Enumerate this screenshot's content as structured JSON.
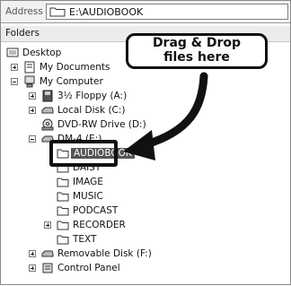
{
  "address": {
    "label": "Address",
    "path": "E:\\AUDIOBOOK"
  },
  "panel": {
    "title": "Folders"
  },
  "tree": {
    "desktop": "Desktop",
    "my_documents": "My Documents",
    "my_computer": "My Computer",
    "floppy": "3½ Floppy (A:)",
    "local_disk": "Local Disk (C:)",
    "dvd": "DVD-RW Drive (D:)",
    "dm4": "DM-4 (E:)",
    "audiobook": "AUDIOBOOK",
    "daisy": "DAISY",
    "image": "IMAGE",
    "music": "MUSIC",
    "podcast": "PODCAST",
    "recorder": "RECORDER",
    "text": "TEXT",
    "removable": "Removable Disk (F:)",
    "control_panel": "Control Panel"
  },
  "callout": {
    "line1": "Drag & Drop",
    "line2": "files here"
  },
  "icons": [
    "folder-icon",
    "desktop-icon",
    "documents-icon",
    "computer-icon",
    "floppy-icon",
    "drive-icon",
    "dvd-icon",
    "device-icon",
    "control-panel-icon",
    "arrow-icon"
  ]
}
